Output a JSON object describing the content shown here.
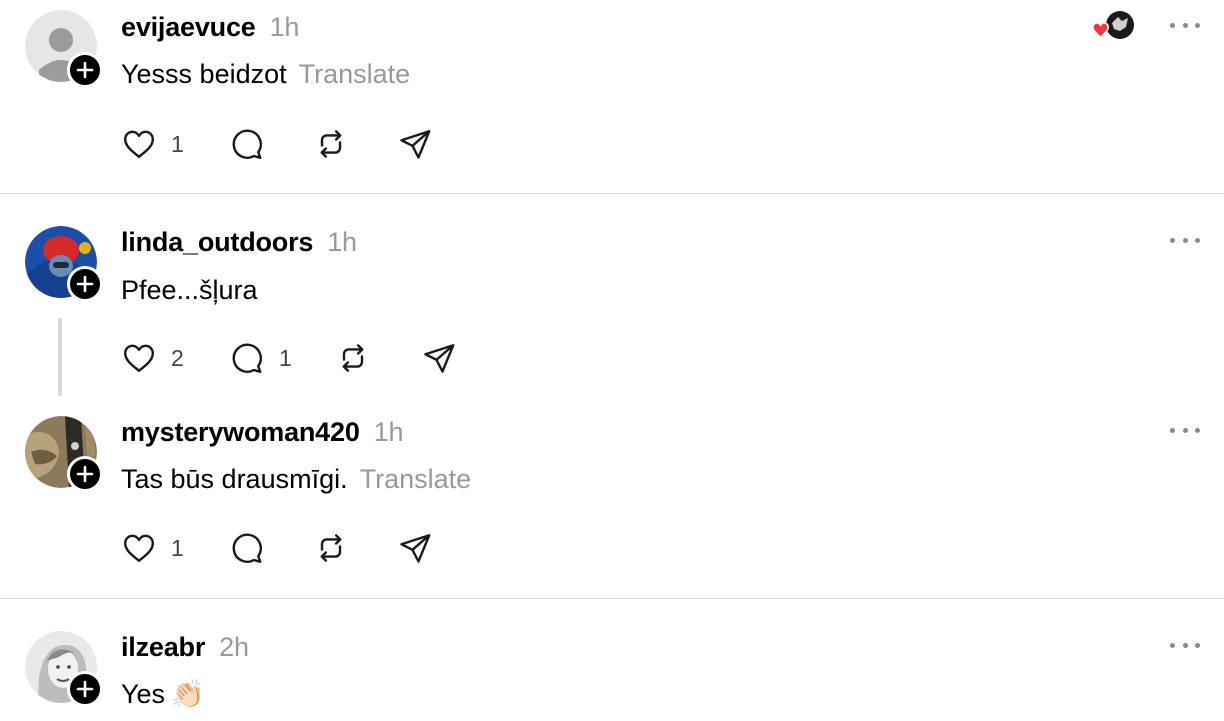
{
  "posts": [
    {
      "username": "evijaevuce",
      "time": "1h",
      "text": "Yesss beidzot",
      "translate": "Translate",
      "likes": "1",
      "replies": "",
      "avatar": "default-avatar-icon"
    },
    {
      "username": "linda_outdoors",
      "time": "1h",
      "text": "Pfee...šļura",
      "translate": "",
      "likes": "2",
      "replies": "1",
      "avatar": "photo-avatar"
    },
    {
      "username": "mysterywoman420",
      "time": "1h",
      "text": "Tas būs drausmīgi.",
      "translate": "Translate",
      "likes": "1",
      "replies": "",
      "avatar": "photo-avatar"
    },
    {
      "username": "ilzeabr",
      "time": "2h",
      "text": "Yes",
      "emoji": "👏🏻",
      "translate": "",
      "avatar": "photo-avatar"
    }
  ],
  "icons": {
    "like": "heart-icon",
    "reply": "comment-icon",
    "repost": "repost-icon",
    "share": "send-icon",
    "more": "more-icon",
    "follow": "plus-icon"
  },
  "colors": {
    "muted_text": "#999999",
    "divider": "#dbdbdb",
    "like_red": "#ff3040"
  }
}
